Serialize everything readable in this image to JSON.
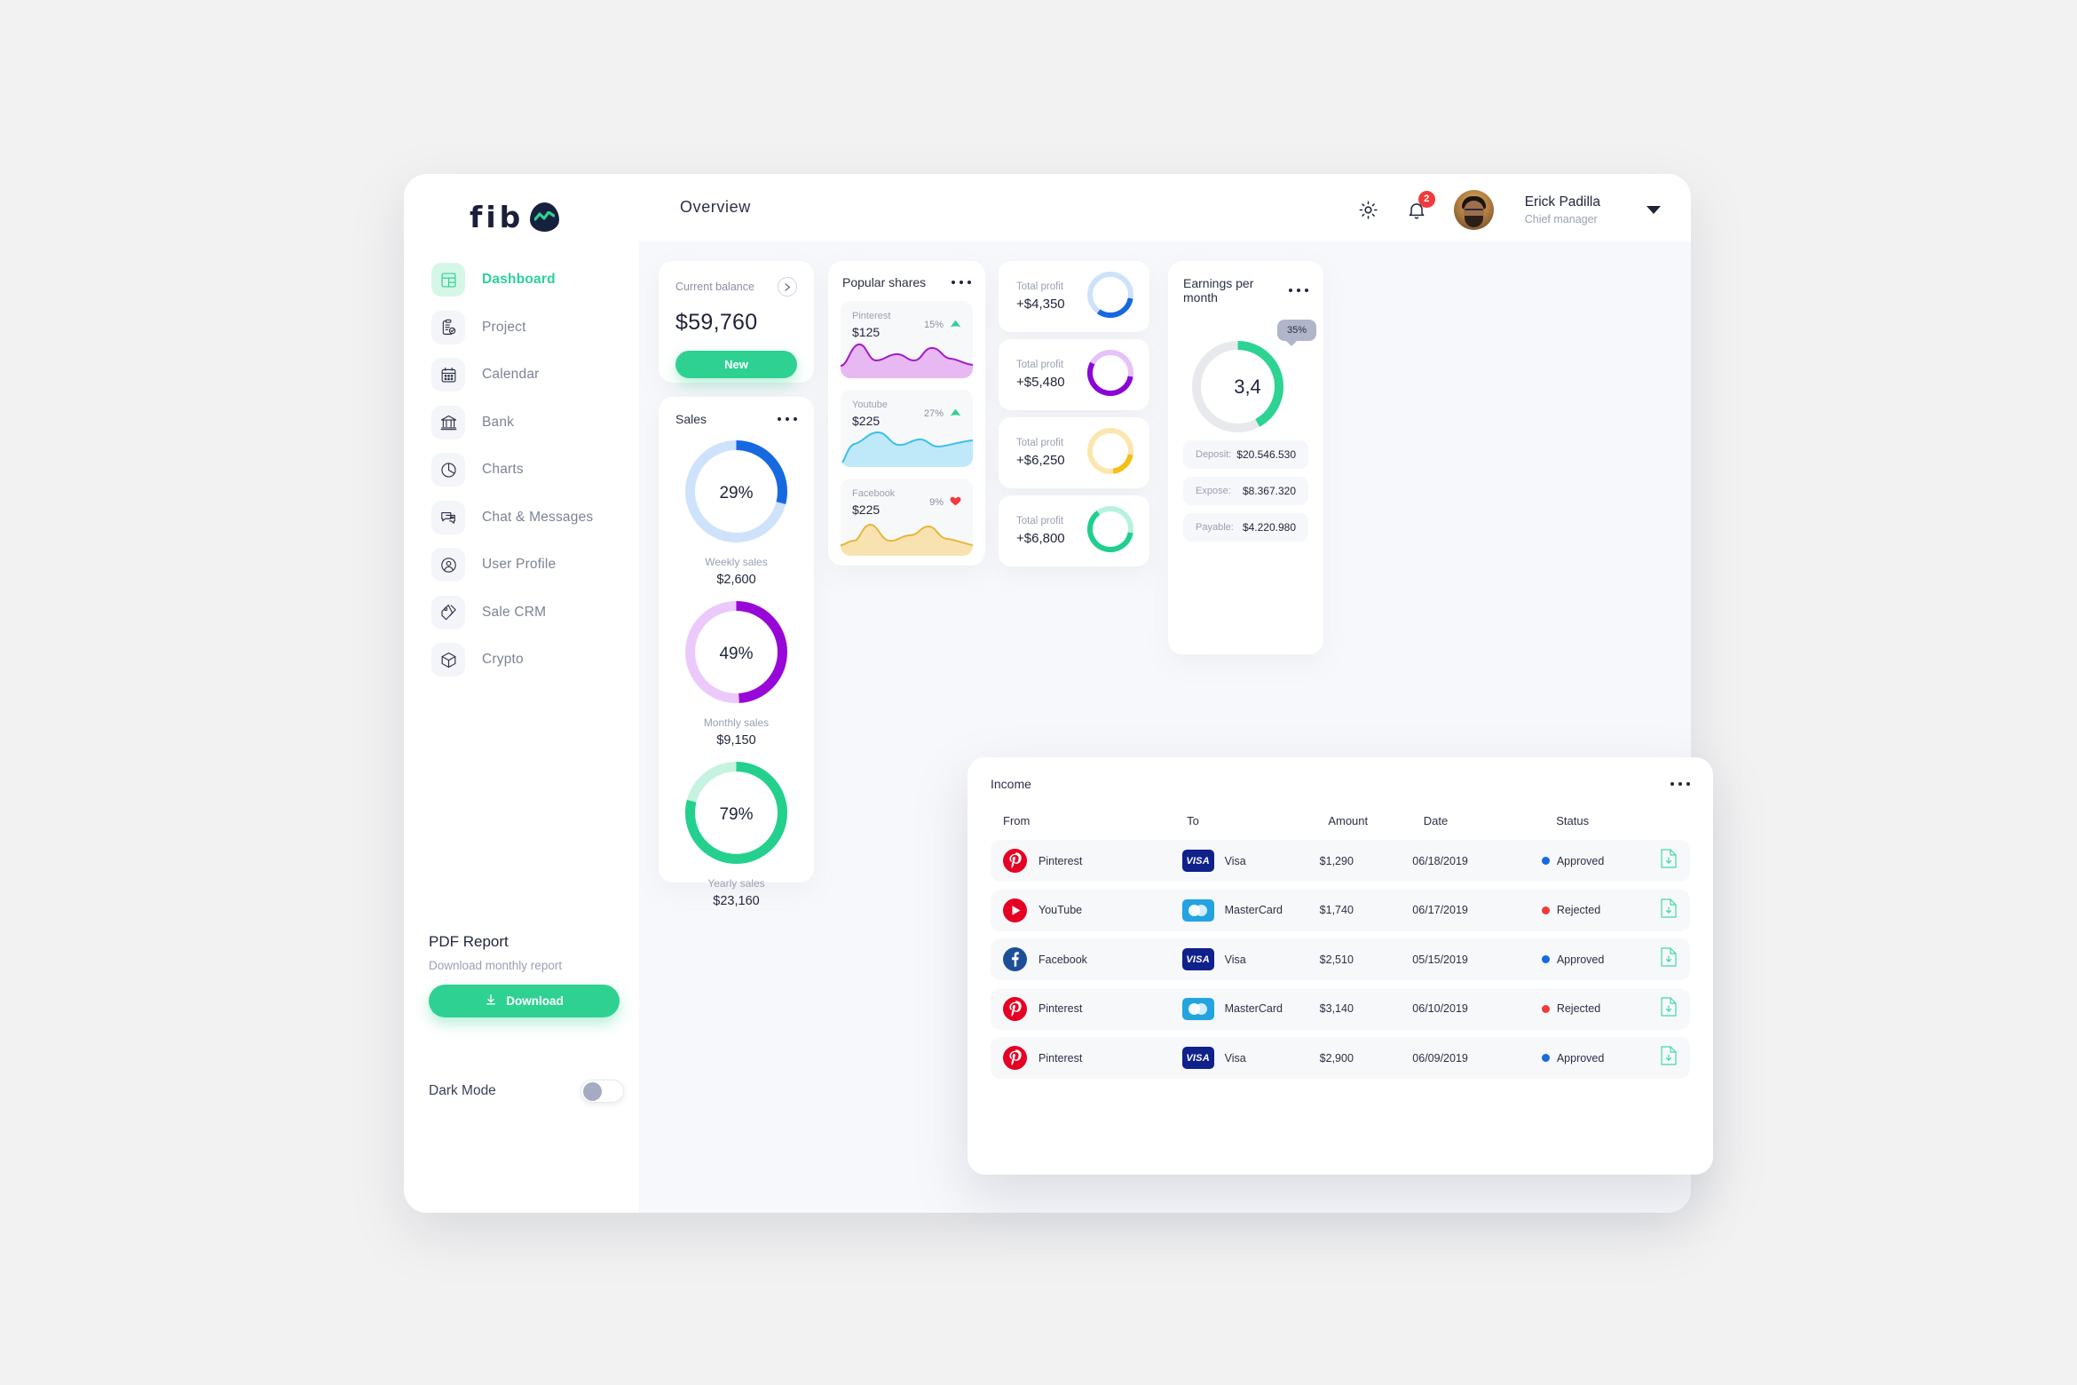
{
  "header": {
    "page_title": "Overview",
    "gear_icon": "gear-icon",
    "bell_icon": "bell-icon",
    "notification_count": "2",
    "user_name": "Erick Padilla",
    "user_role": "Chief manager"
  },
  "brand": {
    "text": "fib",
    "mark_icon": "chart-wave-icon"
  },
  "sidebar": {
    "items": [
      {
        "label": "Dashboard",
        "icon": "dashboard-grid-icon",
        "active": true
      },
      {
        "label": "Project",
        "icon": "clipboard-check-icon",
        "active": false
      },
      {
        "label": "Calendar",
        "icon": "calendar-icon",
        "active": false
      },
      {
        "label": "Bank",
        "icon": "bank-icon",
        "active": false
      },
      {
        "label": "Charts",
        "icon": "pie-chart-icon",
        "active": false
      },
      {
        "label": "Chat & Messages",
        "icon": "chat-bubble-icon",
        "active": false
      },
      {
        "label": "User Profile",
        "icon": "user-circle-icon",
        "active": false
      },
      {
        "label": "Sale CRM",
        "icon": "price-tag-icon",
        "active": false
      },
      {
        "label": "Crypto",
        "icon": "cube-icon",
        "active": false
      }
    ],
    "pdf": {
      "title": "PDF Report",
      "subtitle": "Download monthly report",
      "button_label": "Download",
      "button_icon": "download-icon",
      "button_color": "#2fd193"
    },
    "dark_mode": {
      "label": "Dark Mode",
      "enabled": false
    }
  },
  "balance": {
    "label": "Current balance",
    "value": "$59,760",
    "button_label": "New",
    "arrow_icon": "chevron-right-icon",
    "accent": "#2fd193"
  },
  "sales": {
    "title": "Sales",
    "menu_icon": "more-horizontal-icon",
    "rings": [
      {
        "percent": "29%",
        "value": 29,
        "name": "Weekly sales",
        "amount": "$2,600",
        "color": "#1769e0",
        "track": "#cfe2fb"
      },
      {
        "percent": "49%",
        "value": 49,
        "name": "Monthly sales",
        "amount": "$9,150",
        "color": "#9708d8",
        "track": "#ecc9fb"
      },
      {
        "percent": "79%",
        "value": 79,
        "name": "Yearly sales",
        "amount": "$23,160",
        "color": "#24d08e",
        "track": "#c5f3e0"
      }
    ]
  },
  "popular_shares": {
    "title": "Popular shares",
    "menu_icon": "more-horizontal-icon",
    "items": [
      {
        "name": "Pinterest",
        "price": "$125",
        "percent": "15%",
        "trend": "up",
        "trend_icon": "triangle-up-icon",
        "color": "#a21bc9",
        "fill": "#e8b8f3"
      },
      {
        "name": "Youtube",
        "price": "$225",
        "percent": "27%",
        "trend": "up",
        "trend_icon": "triangle-up-icon",
        "color": "#3cc0e8",
        "fill": "#bfe9f8"
      },
      {
        "name": "Facebook",
        "price": "$225",
        "percent": "9%",
        "trend": "down",
        "trend_icon": "heart-down-icon",
        "color": "#e8b53c",
        "fill": "#f8e3b0"
      }
    ]
  },
  "total_profit": [
    {
      "label": "Total profit",
      "value": "+$4,350",
      "percent": 32,
      "color": "#1769e0",
      "track": "#cfe2fb"
    },
    {
      "label": "Total profit",
      "value": "+$5,480",
      "percent": 55,
      "color": "#8a07d6",
      "track": "#e5c3f8"
    },
    {
      "label": "Total profit",
      "value": "+$6,250",
      "percent": 20,
      "color": "#f5bf16",
      "track": "#fbe7ae"
    },
    {
      "label": "Total profit",
      "value": "+$6,800",
      "percent": 62,
      "color": "#1fcf8d",
      "track": "#b9f2dc"
    }
  ],
  "earnings": {
    "title": "Earnings per month",
    "menu_icon": "more-horizontal-icon",
    "bubble_percent": "35%",
    "center_value": "3,4",
    "ring_value": 42,
    "ring_color": "#2dd393",
    "ring_track": "#e8e9ec",
    "rows": [
      {
        "key": "Deposit:",
        "value": "$20.546.530"
      },
      {
        "key": "Expose:",
        "value": "$8.367.320"
      },
      {
        "key": "Payable:",
        "value": "$4.220.980"
      }
    ]
  },
  "income": {
    "title": "Income",
    "menu_icon": "more-horizontal-icon",
    "columns": [
      "From",
      "To",
      "Amount",
      "Date",
      "Status"
    ],
    "rows": [
      {
        "from": "Pinterest",
        "from_icon": "pinterest-icon",
        "to": "Visa",
        "to_icon": "visa-card-icon",
        "amount": "$1,290",
        "date": "06/18/2019",
        "status": "Approved",
        "status_color": "#1769e0",
        "action_icon": "download-file-icon"
      },
      {
        "from": "YouTube",
        "from_icon": "youtube-icon",
        "to": "MasterCard",
        "to_icon": "mastercard-icon",
        "amount": "$1,740",
        "date": "06/17/2019",
        "status": "Rejected",
        "status_color": "#ef3b3b",
        "action_icon": "download-file-icon"
      },
      {
        "from": "Facebook",
        "from_icon": "facebook-icon",
        "to": "Visa",
        "to_icon": "visa-card-icon",
        "amount": "$2,510",
        "date": "05/15/2019",
        "status": "Approved",
        "status_color": "#1769e0",
        "action_icon": "download-file-icon"
      },
      {
        "from": "Pinterest",
        "from_icon": "pinterest-icon",
        "to": "MasterCard",
        "to_icon": "mastercard-icon",
        "amount": "$3,140",
        "date": "06/10/2019",
        "status": "Rejected",
        "status_color": "#ef3b3b",
        "action_icon": "download-file-icon"
      },
      {
        "from": "Pinterest",
        "from_icon": "pinterest-icon",
        "to": "Visa",
        "to_icon": "visa-card-icon",
        "amount": "$2,900",
        "date": "06/09/2019",
        "status": "Approved",
        "status_color": "#1769e0",
        "action_icon": "download-file-icon"
      }
    ]
  }
}
